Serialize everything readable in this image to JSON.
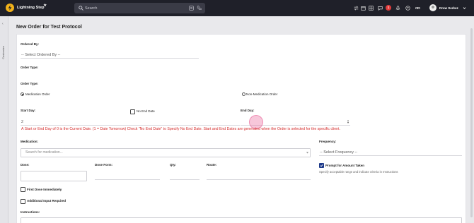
{
  "app": {
    "brand": "Lightning Step",
    "search_placeholder": "Search",
    "notification_count": "1",
    "user_name": "Drew Serkez"
  },
  "sidebar": {
    "collapsed_label": "Customize"
  },
  "page": {
    "title": "New Order for Test Protocol"
  },
  "form": {
    "ordered_by": {
      "label": "Ordered By:",
      "value": "-- Select Ordered By --"
    },
    "order_type_1": {
      "label": "Order Type:"
    },
    "order_type_2": {
      "label": "Order Type:",
      "options": [
        "Medication Order",
        "Non-Medication Order"
      ],
      "selected": "Medication Order"
    },
    "start_day": {
      "label": "Start Day:",
      "value": "2"
    },
    "no_end_date": {
      "label": "No End Date",
      "checked": false
    },
    "end_day": {
      "label": "End Day:",
      "value": ""
    },
    "note": "A Start or End Day of 0 is the Current Date. (1 = Date Tomorrow) Check \"No End Date\" to Specify No End Date. Start and End Dates are generated when the Order is selected for the specific client.",
    "medication": {
      "label": "Medication:",
      "placeholder": "Search for medication..."
    },
    "frequency": {
      "label": "Frequency:",
      "value": "-- Select Frequency --"
    },
    "dose": {
      "label": "Dose:"
    },
    "dose_form": {
      "label": "Dose Form:"
    },
    "qty": {
      "label": "Qty:"
    },
    "route": {
      "label": "Route:"
    },
    "prompt_amount": {
      "label": "Prompt for Amount Taken",
      "checked": true,
      "hint": "Specify acceptable range and indicate criteria in Instructions"
    },
    "first_dose": {
      "label": "First Dose Immediately",
      "checked": false
    },
    "additional_input": {
      "label": "Additional Input Required",
      "checked": false
    },
    "instructions": {
      "label": "Instructions:"
    }
  }
}
